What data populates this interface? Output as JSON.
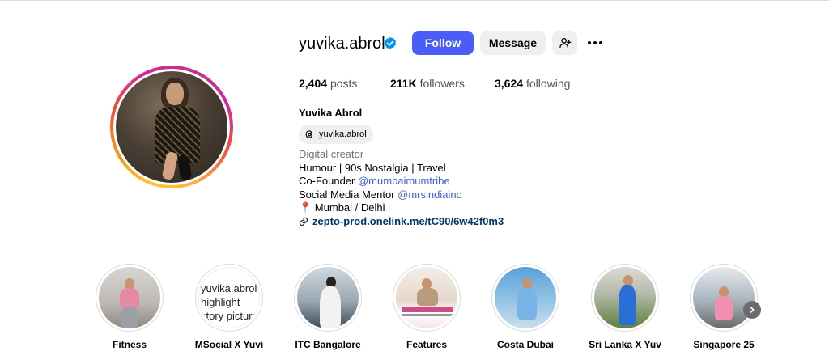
{
  "profile": {
    "username": "yuvika.abrol",
    "verified": true,
    "follow_label": "Follow",
    "message_label": "Message",
    "add_user_icon": "person-add-icon",
    "more_icon": "more-horizontal-icon"
  },
  "stats": {
    "posts_count": "2,404",
    "posts_label": "posts",
    "followers_count": "211K",
    "followers_label": "followers",
    "following_count": "3,624",
    "following_label": "following"
  },
  "bio": {
    "full_name": "Yuvika Abrol",
    "threads_handle": "yuvika.abrol",
    "category": "Digital creator",
    "line1": "Humour | 90s Nostalgia | Travel",
    "line2_prefix": "Co-Founder ",
    "line2_mention": "@mumbaimumtribe",
    "line3_prefix": "Social Media Mentor ",
    "line3_mention": "@mrsindiainc",
    "line4_pin": "📍",
    "line4_text": " Mumbai / Delhi",
    "link": "zepto-prod.onelink.me/tC90/6w42f0m3"
  },
  "highlights": [
    {
      "label": "Fitness"
    },
    {
      "label": "MSocial X Yuvi",
      "broken_alt": "yuvika.abrol's highlight story picture"
    },
    {
      "label": "ITC Bangalore"
    },
    {
      "label": "Features"
    },
    {
      "label": "Costa Dubai"
    },
    {
      "label": "Sri Lanka X Yuv"
    },
    {
      "label": "Singapore 25"
    }
  ],
  "colors": {
    "follow_button": "#4a5df9",
    "secondary_button": "#efefef",
    "mention": "#3a5fd9",
    "link": "#00376b",
    "verified": "#0095f6"
  }
}
